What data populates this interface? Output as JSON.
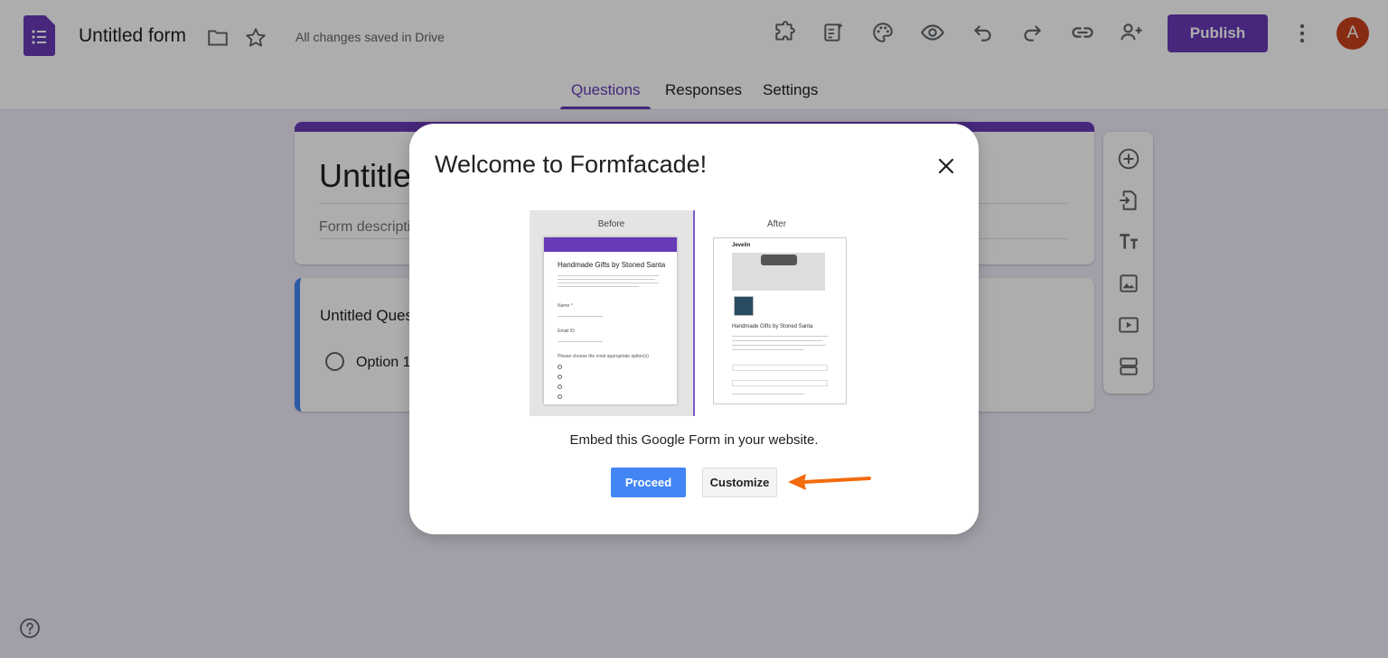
{
  "header": {
    "title": "Untitled form",
    "save_status": "All changes saved in Drive",
    "publish_label": "Publish",
    "avatar_initial": "A"
  },
  "tabs": [
    {
      "label": "Questions",
      "active": true
    },
    {
      "label": "Responses",
      "active": false
    },
    {
      "label": "Settings",
      "active": false
    }
  ],
  "form": {
    "title": "Untitled form",
    "description_placeholder": "Form description",
    "question_title": "Untitled Question",
    "option_label": "Option 1"
  },
  "toolbar_icons": [
    "add-ons-icon",
    "customize-icon",
    "palette-icon",
    "preview-icon",
    "undo-icon",
    "redo-icon",
    "link-icon",
    "add-collaborator-icon"
  ],
  "side_toolbar_icons": [
    "add-question-icon",
    "import-questions-icon",
    "add-title-icon",
    "add-image-icon",
    "add-video-icon",
    "add-section-icon"
  ],
  "modal": {
    "title": "Welcome to Formfacade!",
    "preview": {
      "before_label": "Before",
      "after_label": "After",
      "form_title": "Handmade Gifts by Stoned Santa",
      "name_label": "Name *",
      "email_label": "Email ID",
      "choice_label": "Please choose the most appropriate option(s)",
      "brand": "Jevelin"
    },
    "description": "Embed this Google Form in your website.",
    "proceed_label": "Proceed",
    "customize_label": "Customize"
  },
  "colors": {
    "brand_purple": "#673ab7",
    "proceed_blue": "#4285f4",
    "arrow_orange": "#f26b0f",
    "avatar": "#c8421c"
  }
}
